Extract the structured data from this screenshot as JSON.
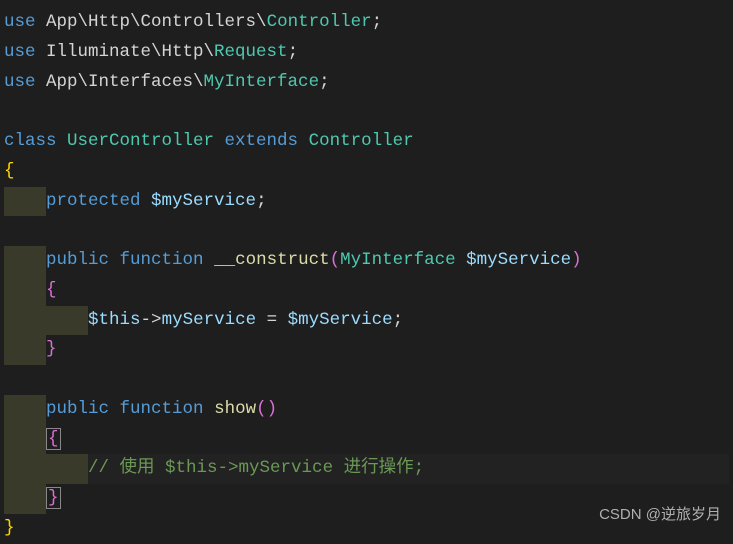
{
  "code": {
    "use1_keyword": "use",
    "use1_ns": " App\\Http\\Controllers\\",
    "use1_class": "Controller",
    "semicolon": ";",
    "use2_keyword": "use",
    "use2_ns": " Illuminate\\Http\\",
    "use2_class": "Request",
    "use3_keyword": "use",
    "use3_ns": " App\\Interfaces\\",
    "use3_class": "MyInterface",
    "class_kw": "class",
    "class_name": " UserController ",
    "extends_kw": "extends",
    "parent_class": " Controller",
    "open_brace": "{",
    "protected_kw": "protected",
    "prop_name": " $myService",
    "public_kw": "public",
    "function_kw": " function ",
    "construct_name": "__construct",
    "open_paren": "(",
    "param_type": "MyInterface",
    "param_var": " $myService",
    "close_paren": ")",
    "this_var": "$this",
    "arrow": "->",
    "prop_access": "myService",
    "equals": " = ",
    "assign_var": "$myService",
    "show_name": "show",
    "comment_text": "// 使用 $this->myService 进行操作;",
    "close_brace": "}",
    "indent1": "    ",
    "indent2": "        "
  },
  "watermark": "CSDN @逆旅岁月"
}
